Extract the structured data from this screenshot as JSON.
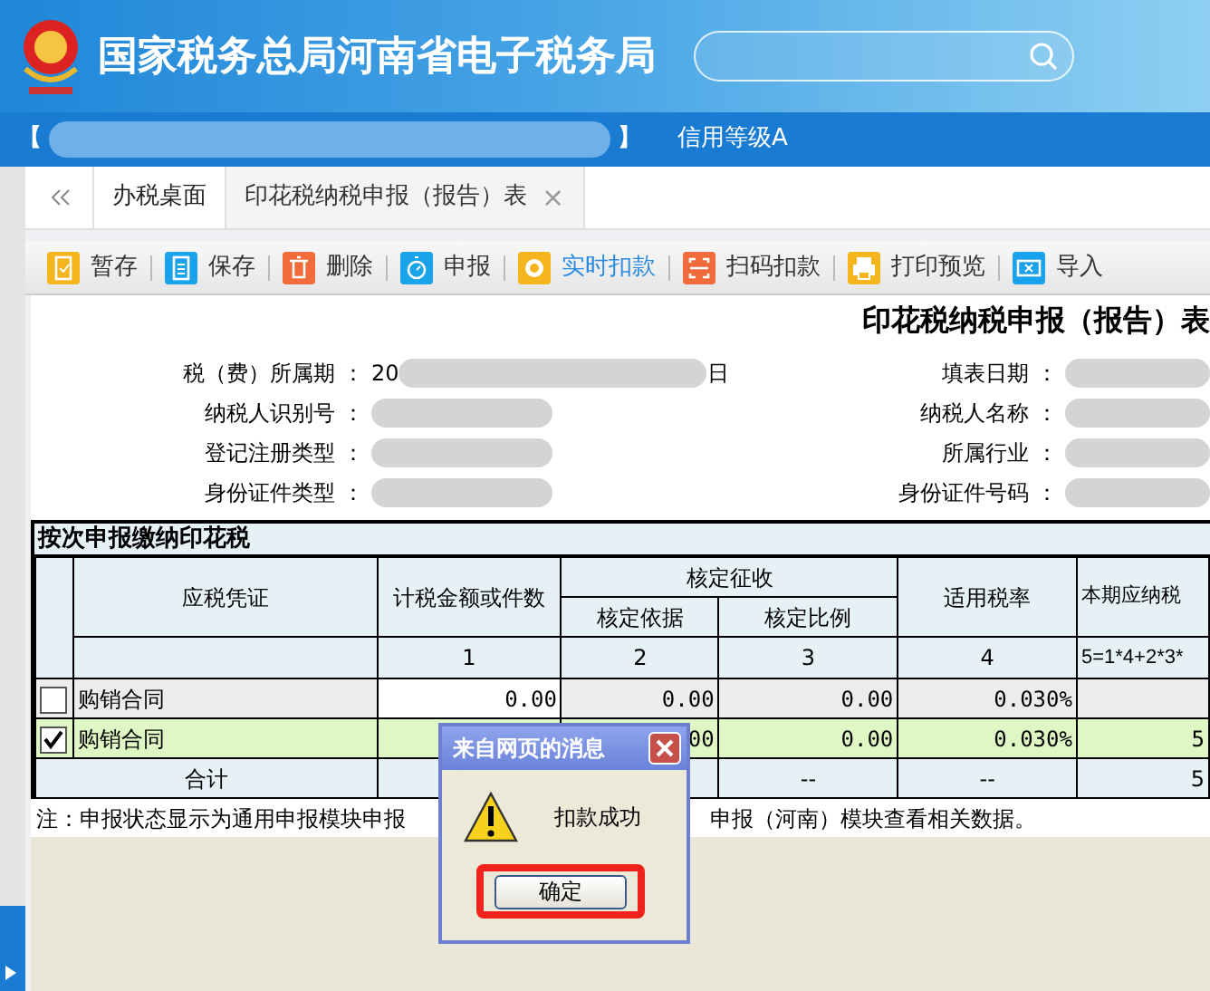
{
  "header": {
    "title": "国家税务总局河南省电子税务局"
  },
  "account_bar": {
    "open_bracket": "【",
    "close_bracket": "】",
    "credit": "信用等级A"
  },
  "tabs": [
    {
      "label": "办税桌面",
      "selected": false,
      "closable": false
    },
    {
      "label": "印花税纳税申报（报告）表",
      "selected": true,
      "closable": true,
      "close": "×"
    }
  ],
  "toolbar": [
    {
      "label": "暂存",
      "kind": "clipboard",
      "active": false
    },
    {
      "label": "保存",
      "kind": "document",
      "active": false
    },
    {
      "label": "删除",
      "kind": "trash",
      "active": false
    },
    {
      "label": "申报",
      "kind": "timer",
      "active": false
    },
    {
      "label": "实时扣款",
      "kind": "coin",
      "active": true
    },
    {
      "label": "扫码扣款",
      "kind": "scan",
      "active": false
    },
    {
      "label": "打印预览",
      "kind": "printer",
      "active": false
    },
    {
      "label": "导入",
      "kind": "ticket",
      "active": false
    }
  ],
  "form": {
    "title": "印花税纳税申报（报告）表",
    "colon": "：",
    "left_fields": [
      {
        "label": "税（费）所属期",
        "prefix": "20",
        "suffix": "日"
      },
      {
        "label": "纳税人识别号"
      },
      {
        "label": "登记注册类型"
      },
      {
        "label": "身份证件类型"
      }
    ],
    "right_fields": [
      {
        "label": "填表日期"
      },
      {
        "label": "纳税人名称"
      },
      {
        "label": "所属行业"
      },
      {
        "label": "身份证件号码"
      }
    ]
  },
  "section": {
    "title": "按次申报缴纳印花税"
  },
  "table": {
    "headers": {
      "voucher": "应税凭证",
      "amount": "计税金额或件数",
      "assessed": "核定征收",
      "basis": "核定依据",
      "ratio": "核定比例",
      "rate": "适用税率",
      "payable": "本期应纳税"
    },
    "numbers": [
      "1",
      "2",
      "3",
      "4",
      "5=1*4+2*3*"
    ],
    "rows": [
      {
        "checked": false,
        "voucher": "购销合同",
        "cells": [
          "0.00",
          "0.00",
          "0.00",
          "0.030%",
          null
        ]
      },
      {
        "checked": true,
        "voucher": "购销合同",
        "cells": [
          null,
          "00",
          "0.00",
          "0.030%",
          "5"
        ]
      }
    ],
    "total": {
      "label": "合计",
      "cells": [
        null,
        null,
        "--",
        "--",
        "5"
      ]
    }
  },
  "note": {
    "before": "注：申报状态显示为通用申报模块申报",
    "after": "申报（河南）模块查看相关数据。"
  },
  "dialog": {
    "title": "来自网页的消息",
    "message": "扣款成功",
    "button": "确定",
    "highlighted": true
  }
}
